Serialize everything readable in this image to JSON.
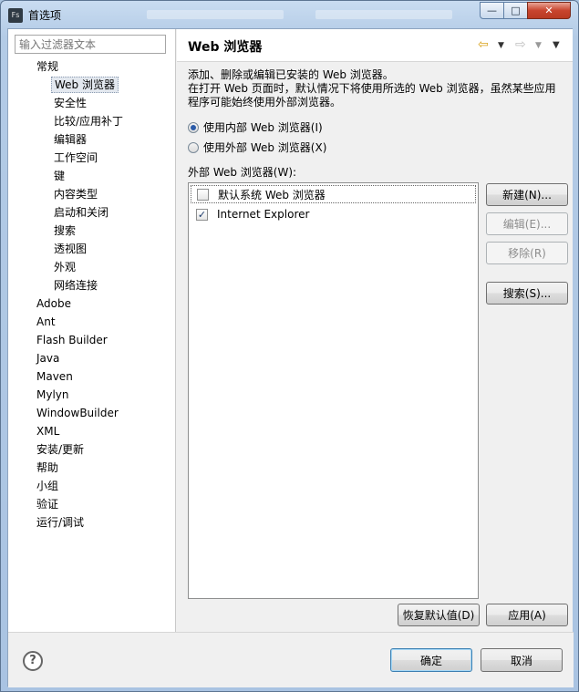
{
  "window": {
    "title": "首选项",
    "icon_text": "Fs",
    "controls": {
      "minimize": "—",
      "maximize": "□",
      "close": "✕"
    }
  },
  "filter": {
    "placeholder": "输入过滤器文本",
    "value": ""
  },
  "tree": {
    "items": [
      {
        "label": "常规",
        "level": 0
      },
      {
        "label": "Web 浏览器",
        "level": 1,
        "selected": true
      },
      {
        "label": "安全性",
        "level": 1
      },
      {
        "label": "比较/应用补丁",
        "level": 1
      },
      {
        "label": "编辑器",
        "level": 1
      },
      {
        "label": "工作空间",
        "level": 1
      },
      {
        "label": "键",
        "level": 1
      },
      {
        "label": "内容类型",
        "level": 1
      },
      {
        "label": "启动和关闭",
        "level": 1
      },
      {
        "label": "搜索",
        "level": 1
      },
      {
        "label": "透视图",
        "level": 1
      },
      {
        "label": "外观",
        "level": 1
      },
      {
        "label": "网络连接",
        "level": 1
      },
      {
        "label": "Adobe",
        "level": 0
      },
      {
        "label": "Ant",
        "level": 0
      },
      {
        "label": "Flash Builder",
        "level": 0
      },
      {
        "label": "Java",
        "level": 0
      },
      {
        "label": "Maven",
        "level": 0
      },
      {
        "label": "Mylyn",
        "level": 0
      },
      {
        "label": "WindowBuilder",
        "level": 0
      },
      {
        "label": "XML",
        "level": 0
      },
      {
        "label": "安装/更新",
        "level": 0
      },
      {
        "label": "帮助",
        "level": 0
      },
      {
        "label": "小组",
        "level": 0
      },
      {
        "label": "验证",
        "level": 0
      },
      {
        "label": "运行/调试",
        "level": 0
      }
    ]
  },
  "page": {
    "title": "Web 浏览器",
    "nav": {
      "back": "⇦",
      "back_dd": "▼",
      "forward": "⇨",
      "forward_dd": "▼",
      "menu": "▼"
    },
    "description": [
      "添加、删除或编辑已安装的 Web 浏览器。",
      "在打开 Web 页面时，默认情况下将使用所选的 Web 浏览器，虽然某些应用",
      "程序可能始终使用外部浏览器。"
    ],
    "radio_internal": {
      "label": "使用内部 Web 浏览器(I)",
      "checked": true
    },
    "radio_external": {
      "label": "使用外部 Web 浏览器(X)",
      "checked": false
    },
    "list_label": "外部 Web 浏览器(W):",
    "browsers": [
      {
        "label": "默认系统 Web 浏览器",
        "checked": false,
        "check_mark": ""
      },
      {
        "label": "Internet Explorer",
        "checked": true,
        "check_mark": "✓"
      }
    ],
    "buttons": {
      "new": "新建(N)...",
      "edit": "编辑(E)...",
      "remove": "移除(R)",
      "search": "搜索(S)...",
      "restore_defaults": "恢复默认值(D)",
      "apply": "应用(A)"
    }
  },
  "footer": {
    "help": "?",
    "ok": "确定",
    "cancel": "取消"
  }
}
